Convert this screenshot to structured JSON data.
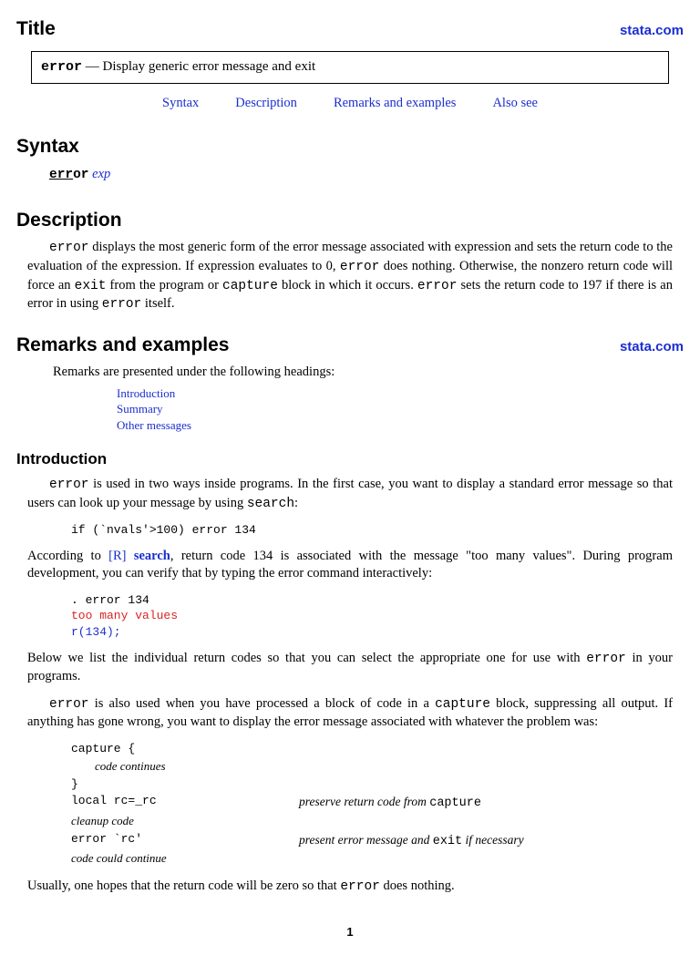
{
  "header": {
    "title": "Title",
    "brand": "stata.com"
  },
  "titleBox": {
    "cmd": "error",
    "sep": " — ",
    "desc": "Display generic error message and exit"
  },
  "nav": {
    "syntax": "Syntax",
    "description": "Description",
    "remarks": "Remarks and examples",
    "also": "Also see"
  },
  "syntax": {
    "heading": "Syntax",
    "cmd_u": "err",
    "cmd_rest": "or",
    "arg": " exp"
  },
  "description": {
    "heading": "Description",
    "p1a": "error",
    "p1b": " displays the most generic form of the error message associated with expression and sets the return code to the evaluation of the expression. If expression evaluates to 0, ",
    "p1c": "error",
    "p1d": " does nothing. Otherwise, the nonzero return code will force an ",
    "p1e": "exit",
    "p1f": " from the program or ",
    "p1g": "capture",
    "p1h": " block in which it occurs. ",
    "p1i": "error",
    "p1j": " sets the return code to 197 if there is an error in using ",
    "p1k": "error",
    "p1l": " itself."
  },
  "remarks": {
    "heading": "Remarks and examples",
    "brand": "stata.com",
    "intro": "Remarks are presented under the following headings:",
    "links": {
      "a": "Introduction",
      "b": "Summary",
      "c": "Other messages"
    }
  },
  "intro": {
    "heading": "Introduction",
    "p1a": "error",
    "p1b": " is used in two ways inside programs. In the first case, you want to display a standard error message so that users can look up your message by using ",
    "p1c": "search",
    "p1d": ":",
    "code1": "if (`nvals'>100) error 134",
    "p2a": "According to ",
    "p2b_r": "[R]",
    "p2b_s": " search",
    "p2c": ", return code 134 is associated with the message \"too many values\". During program development, you can verify that by typing the error command interactively:",
    "code2": {
      "l1": ". error 134",
      "l2": "too many values",
      "l3": "r(134);"
    },
    "p3a": "Below we list the individual return codes so that you can select the appropriate one for use with ",
    "p3b": "error",
    "p3c": " in your programs.",
    "p4a": "error",
    "p4b": " is also used when you have processed a block of code in a ",
    "p4c": "capture",
    "p4d": " block, suppressing all output. If anything has gone wrong, you want to display the error message associated with whatever the problem was:",
    "block": {
      "r1c1": "capture {",
      "r2c1": "        code continues",
      "r3c1": "}",
      "r4c1": "local rc=_rc",
      "r4c2a": "preserve return code from ",
      "r4c2b": "capture",
      "r5c1": "cleanup code",
      "r6c1": "error `rc'",
      "r6c2a": "present error message and ",
      "r6c2b": "exit",
      "r6c2c": " if necessary",
      "r7c1": "code could continue"
    },
    "p5a": "Usually, one hopes that the return code will be zero so that ",
    "p5b": "error",
    "p5c": " does nothing."
  },
  "page": "1"
}
